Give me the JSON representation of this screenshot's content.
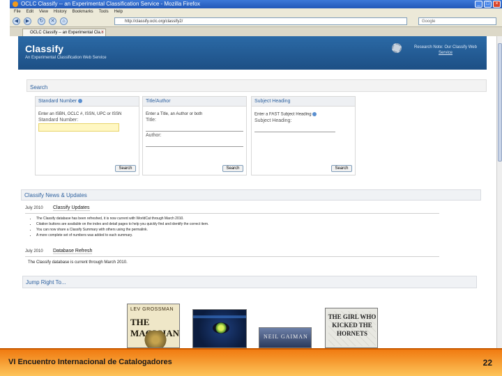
{
  "window": {
    "title": "OCLC Classify -- an Experimental Classification Service - Mozilla Firefox",
    "controls": [
      "_",
      "□",
      "×"
    ]
  },
  "menu": [
    "File",
    "Edit",
    "View",
    "History",
    "Bookmarks",
    "Tools",
    "Help"
  ],
  "nav": {
    "url": "http://classify.oclc.org/classify2/",
    "search_placeholder": "Google"
  },
  "tab": {
    "label": "OCLC Classify -- an Experimental Cla...",
    "close": "×"
  },
  "site": {
    "title": "Classify",
    "tagline": "An Experimental Classification Web Service",
    "header_note_line1": "Research Note: Our Classify Web",
    "header_note_link": "Service"
  },
  "search": {
    "heading": "Search",
    "panels": [
      {
        "heading": "Standard Number",
        "help": "Enter an ISBN, OCLC #, ISSN, UPC or ISSN",
        "fields": [
          {
            "label": "Standard Number:"
          }
        ],
        "button": "Search"
      },
      {
        "heading": "Title/Author",
        "help": "Enter a Title, an Author or both",
        "fields": [
          {
            "label": "Title:"
          },
          {
            "label": "Author:"
          }
        ],
        "button": "Search"
      },
      {
        "heading": "Subject Heading",
        "help": "Enter a FAST Subject Heading",
        "fields": [
          {
            "label": "Subject Heading:"
          }
        ],
        "button": "Search"
      }
    ]
  },
  "news": {
    "heading": "Classify News & Updates",
    "items": [
      {
        "date": "July 2010",
        "title": "Classify Updates",
        "bullets": [
          "The Classify database has been refreshed, it is now current with WorldCat through March 2010.",
          "Citation buttons are available on the index and detail pages to help you quickly find and identify the correct item.",
          "You can now share a Classify Summary with others using the permalink.",
          "A more complete set of numbers was added to each summary."
        ]
      },
      {
        "date": "July 2010",
        "title": "Database Refresh",
        "body": "The Classify database is current through March 2010."
      }
    ]
  },
  "jump": {
    "heading": "Jump Right To..."
  },
  "books": [
    {
      "author": "LEV GROSSMAN",
      "title": "THE MAGICIANS"
    },
    {
      "title": ""
    },
    {
      "author": "NEIL GAIMAN"
    },
    {
      "title": "THE GIRL WHO KICKED THE HORNETS"
    }
  ],
  "slide_footer": {
    "title": "VI Encuentro Internacional de Catalogadores",
    "page": "22"
  },
  "colors": {
    "header_blue": "#2b6aa6",
    "link_blue": "#2b5f9e",
    "footer_orange": "#f07a10"
  }
}
